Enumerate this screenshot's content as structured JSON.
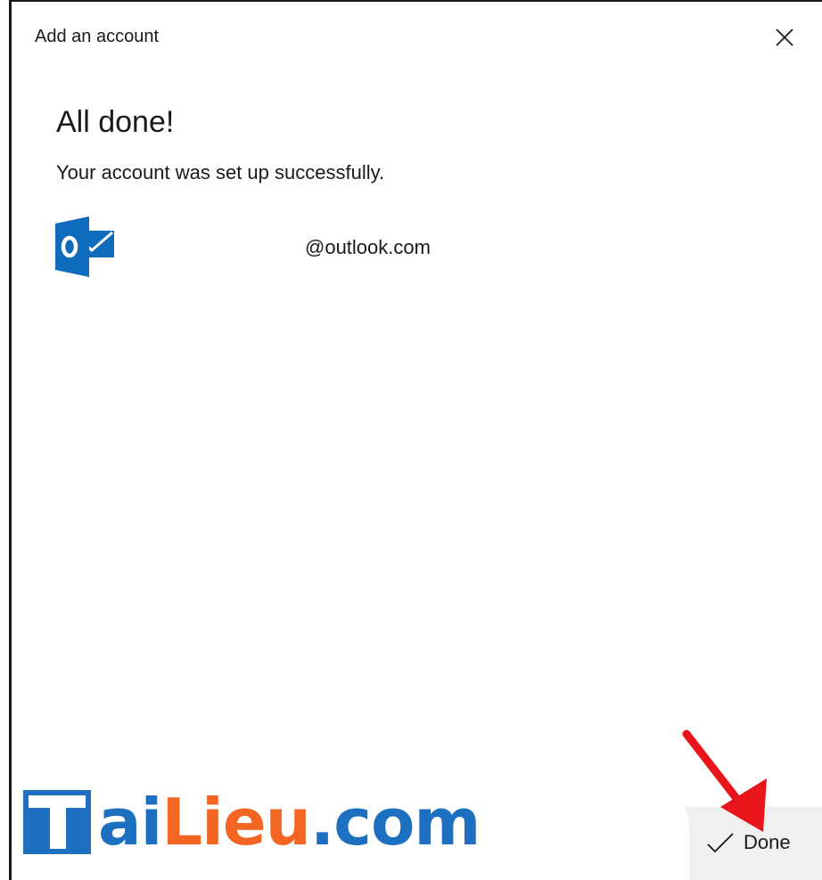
{
  "dialog": {
    "title": "Add an account"
  },
  "content": {
    "heading": "All done!",
    "message": "Your account was set up successfully.",
    "account": {
      "provider_icon": "outlook-logo-icon",
      "email": "@outlook.com"
    }
  },
  "footer": {
    "done_label": "Done",
    "done_icon": "checkmark-icon"
  },
  "watermark": {
    "part_blue_a": "ai",
    "part_orange": "Lieu",
    "part_blue_b": ".com"
  },
  "colors": {
    "outlook_blue": "#0f6cbd",
    "watermark_blue": "#1d6fbf",
    "watermark_orange": "#f26522",
    "arrow_red": "#e8161b",
    "footer_bg": "#f0f0f0"
  }
}
